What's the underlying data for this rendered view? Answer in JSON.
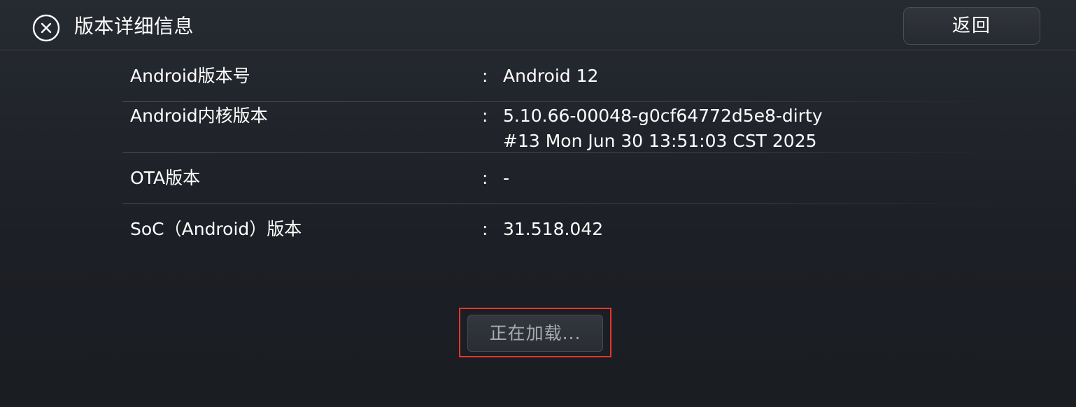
{
  "header": {
    "title": "版本详细信息",
    "back_label": "返回",
    "close_icon": "close-circle-icon"
  },
  "rows": [
    {
      "label": "Android版本号",
      "sep": ":",
      "value": [
        "Android 12"
      ]
    },
    {
      "label": "Android内核版本",
      "sep": ":",
      "value": [
        "5.10.66-00048-g0cf64772d5e8-dirty",
        "#13 Mon Jun 30 13:51:03 CST 2025"
      ]
    },
    {
      "label": "OTA版本",
      "sep": ":",
      "value": [
        "-"
      ]
    },
    {
      "label": "SoC（Android）版本",
      "sep": ":",
      "value": [
        "31.518.042"
      ]
    }
  ],
  "loading": {
    "label": "正在加载..."
  },
  "colors": {
    "background": "#1e2127",
    "highlight": "#e8342c",
    "text": "#ffffff",
    "muted_text": "#a7aab0"
  }
}
